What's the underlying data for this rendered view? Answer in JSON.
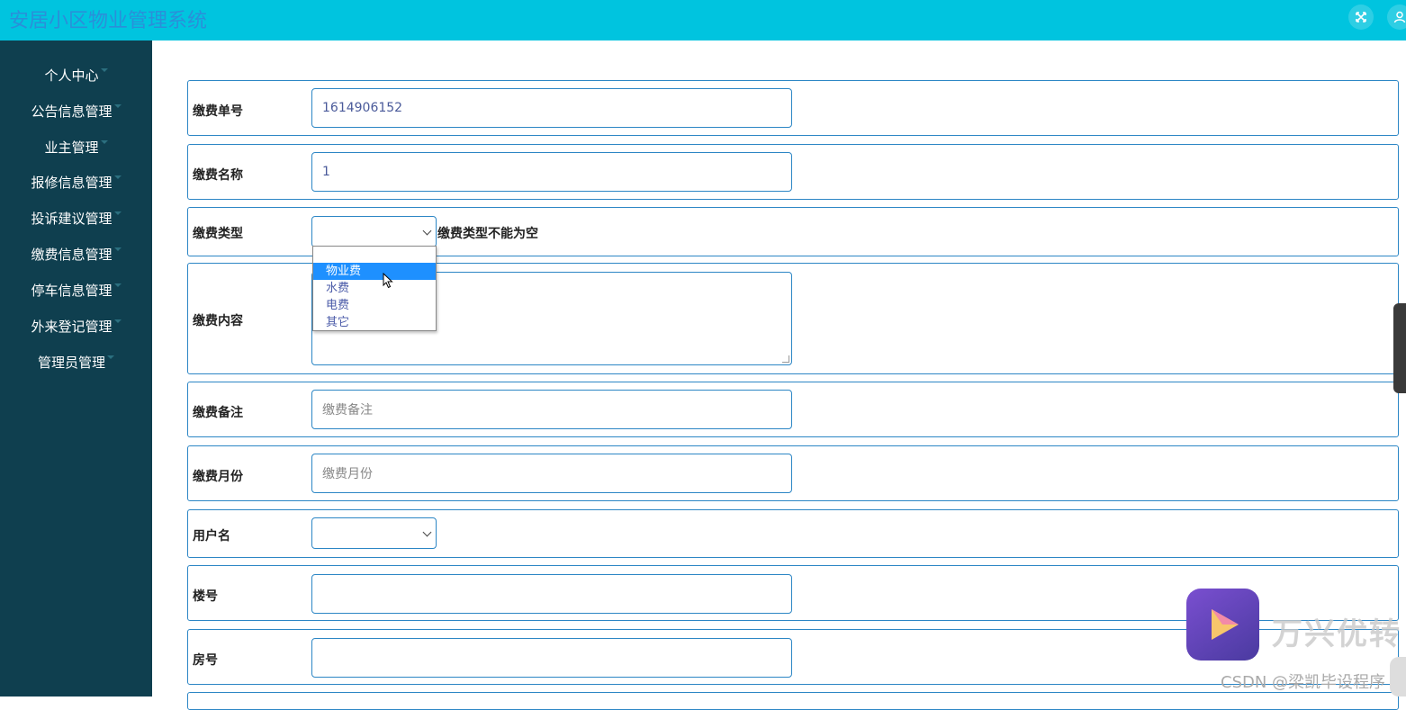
{
  "header": {
    "title": "安居小区物业管理系统",
    "icons": [
      "fullscreen-icon",
      "user-icon"
    ]
  },
  "sidebar": {
    "items": [
      {
        "label": "个人中心"
      },
      {
        "label": "公告信息管理"
      },
      {
        "label": "业主管理"
      },
      {
        "label": "报修信息管理"
      },
      {
        "label": "投诉建议管理"
      },
      {
        "label": "缴费信息管理"
      },
      {
        "label": "停车信息管理"
      },
      {
        "label": "外来登记管理"
      },
      {
        "label": "管理员管理"
      }
    ]
  },
  "form": {
    "bill_no": {
      "label": "缴费单号",
      "value": "1614906152"
    },
    "bill_name": {
      "label": "缴费名称",
      "value": "1"
    },
    "bill_type": {
      "label": "缴费类型",
      "value": "",
      "error": "缴费类型不能为空",
      "options": [
        "",
        "物业费",
        "水费",
        "电费",
        "其它"
      ],
      "highlighted": "物业费"
    },
    "bill_content": {
      "label": "缴费内容",
      "value": ""
    },
    "bill_remark": {
      "label": "缴费备注",
      "placeholder": "缴费备注"
    },
    "bill_month": {
      "label": "缴费月份",
      "placeholder": "缴费月份"
    },
    "username": {
      "label": "用户名",
      "value": ""
    },
    "building": {
      "label": "楼号",
      "value": ""
    },
    "room": {
      "label": "房号",
      "value": ""
    }
  },
  "watermark": {
    "app_text": "万兴优转",
    "csdn": "CSDN @梁凯毕设程序"
  },
  "colors": {
    "header_bg": "#00c4df",
    "sidebar_bg": "#0f3f4f",
    "border_blue": "#2c86c5",
    "option_highlight": "#1e90ff"
  }
}
